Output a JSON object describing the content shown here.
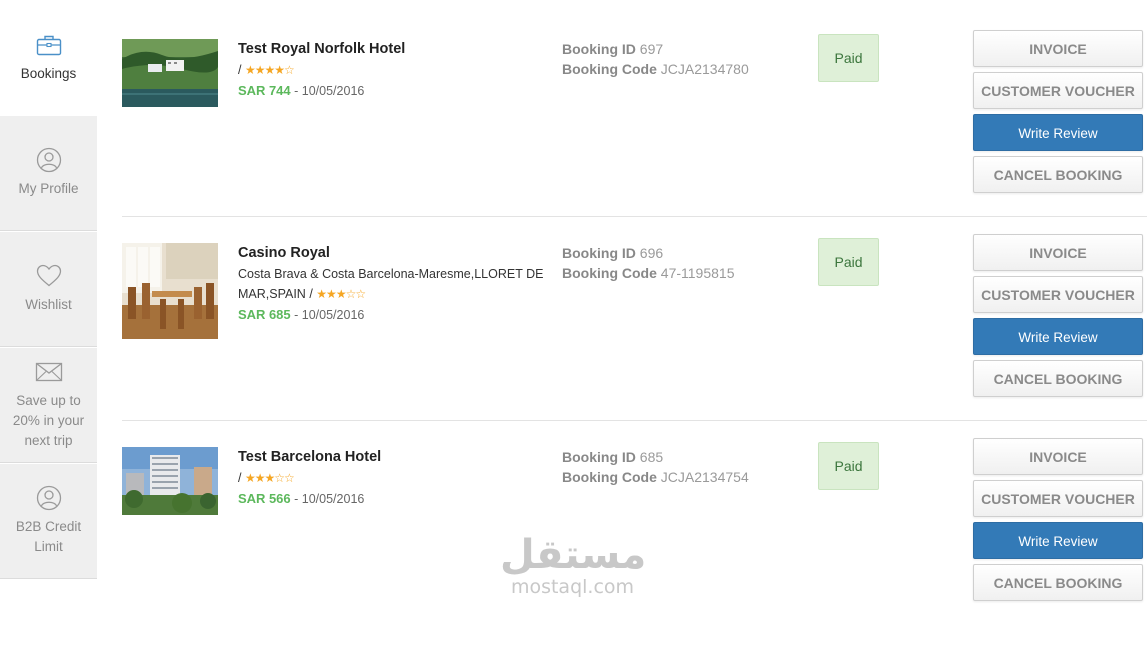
{
  "sidebar": {
    "items": [
      {
        "label": "Bookings",
        "icon": "briefcase-icon"
      },
      {
        "label": "My Profile",
        "icon": "user-icon"
      },
      {
        "label": "Wishlist",
        "icon": "heart-icon"
      },
      {
        "label": "Save up to 20% in your next trip",
        "icon": "envelope-icon"
      },
      {
        "label": "B2B Credit Limit",
        "icon": "user-icon"
      }
    ]
  },
  "bookings": [
    {
      "hotel_name": "Test Royal Norfolk Hotel",
      "location": "",
      "separator": "/",
      "rating": 4,
      "stars_text": "★★★★☆",
      "currency": "SAR",
      "price": "744",
      "dash": "-",
      "date": "10/05/2016",
      "booking_id_label": "Booking ID",
      "booking_id": "697",
      "booking_code_label": "Booking Code",
      "booking_code": "JCJA2134780",
      "status": "Paid"
    },
    {
      "hotel_name": "Casino Royal",
      "location": "Costa Brava & Costa Barcelona-Maresme,LLORET DE MAR,SPAIN",
      "separator": "/",
      "rating": 3,
      "stars_text": "★★★☆☆",
      "currency": "SAR",
      "price": "685",
      "dash": "-",
      "date": "10/05/2016",
      "booking_id_label": "Booking ID",
      "booking_id": "696",
      "booking_code_label": "Booking Code",
      "booking_code": "47-1195815",
      "status": "Paid"
    },
    {
      "hotel_name": "Test Barcelona Hotel",
      "location": "",
      "separator": "/",
      "rating": 3,
      "stars_text": "★★★☆☆",
      "currency": "SAR",
      "price": "566",
      "dash": "-",
      "date": "10/05/2016",
      "booking_id_label": "Booking ID",
      "booking_id": "685",
      "booking_code_label": "Booking Code",
      "booking_code": "JCJA2134754",
      "status": "Paid"
    }
  ],
  "actions": {
    "invoice": "INVOICE",
    "customer_voucher": "CUSTOMER VOUCHER",
    "write_review": "Write Review",
    "cancel_booking": "CANCEL BOOKING"
  },
  "watermark": {
    "arabic": "مستقل",
    "latin": "mostaql.com"
  },
  "colors": {
    "primary_button": "#337ab7",
    "price_green": "#5cb85c",
    "paid_bg": "#dff0d8",
    "star": "#f5a623"
  }
}
